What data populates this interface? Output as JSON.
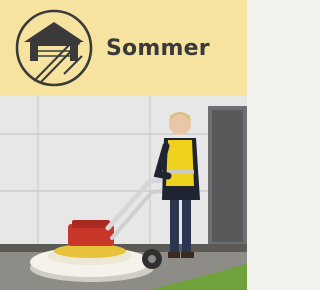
{
  "header": {
    "title": "Sommer",
    "icon": "barn-garage-icon",
    "background_color": "#f7e3a0",
    "text_color": "#3a3a3a"
  },
  "photo": {
    "subject": "person-with-surface-cleaner-machine"
  }
}
